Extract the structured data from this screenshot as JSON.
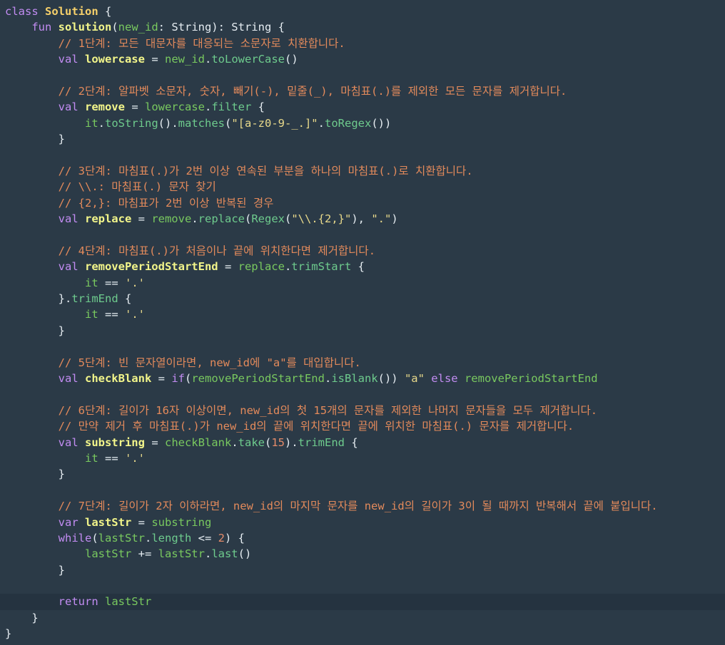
{
  "editor": {
    "lines": [
      {
        "indent": 0,
        "tokens": [
          {
            "t": "class ",
            "c": "kw"
          },
          {
            "t": "Solution",
            "c": "cls bold"
          },
          {
            "t": " {",
            "c": "plain"
          }
        ]
      },
      {
        "indent": 1,
        "tokens": [
          {
            "t": "fun ",
            "c": "kw"
          },
          {
            "t": "solution",
            "c": "fn bold"
          },
          {
            "t": "(",
            "c": "plain"
          },
          {
            "t": "new_id",
            "c": "var"
          },
          {
            "t": ": String): String {",
            "c": "plain"
          }
        ]
      },
      {
        "indent": 2,
        "tokens": [
          {
            "t": "// 1단계: 모든 대문자를 대응되는 소문자로 치환합니다.",
            "c": "cmt"
          }
        ]
      },
      {
        "indent": 2,
        "tokens": [
          {
            "t": "val ",
            "c": "kw"
          },
          {
            "t": "lowercase",
            "c": "id bold"
          },
          {
            "t": " = ",
            "c": "plain"
          },
          {
            "t": "new_id",
            "c": "var"
          },
          {
            "t": ".",
            "c": "plain"
          },
          {
            "t": "toLowerCase",
            "c": "meth"
          },
          {
            "t": "()",
            "c": "plain"
          }
        ]
      },
      {
        "indent": 0,
        "tokens": []
      },
      {
        "indent": 2,
        "tokens": [
          {
            "t": "// 2단계: 알파벳 소문자, 숫자, 빼기(-), 밑줄(_), 마침표(.)를 제외한 모든 문자를 제거합니다.",
            "c": "cmt"
          }
        ]
      },
      {
        "indent": 2,
        "tokens": [
          {
            "t": "val ",
            "c": "kw"
          },
          {
            "t": "remove",
            "c": "id bold"
          },
          {
            "t": " = ",
            "c": "plain"
          },
          {
            "t": "lowercase",
            "c": "var"
          },
          {
            "t": ".",
            "c": "plain"
          },
          {
            "t": "filter",
            "c": "meth"
          },
          {
            "t": " {",
            "c": "plain"
          }
        ]
      },
      {
        "indent": 3,
        "tokens": [
          {
            "t": "it",
            "c": "var"
          },
          {
            "t": ".",
            "c": "plain"
          },
          {
            "t": "toString",
            "c": "meth"
          },
          {
            "t": "().",
            "c": "plain"
          },
          {
            "t": "matches",
            "c": "meth"
          },
          {
            "t": "(",
            "c": "plain"
          },
          {
            "t": "\"[a-z0-9-_.]\"",
            "c": "str"
          },
          {
            "t": ".",
            "c": "plain"
          },
          {
            "t": "toRegex",
            "c": "meth"
          },
          {
            "t": "())",
            "c": "plain"
          }
        ]
      },
      {
        "indent": 2,
        "tokens": [
          {
            "t": "}",
            "c": "plain"
          }
        ]
      },
      {
        "indent": 0,
        "tokens": []
      },
      {
        "indent": 2,
        "tokens": [
          {
            "t": "// 3단계: 마침표(.)가 2번 이상 연속된 부분을 하나의 마침표(.)로 치환합니다.",
            "c": "cmt"
          }
        ]
      },
      {
        "indent": 2,
        "tokens": [
          {
            "t": "// \\\\.: 마침표(.) 문자 찾기",
            "c": "cmt"
          }
        ]
      },
      {
        "indent": 2,
        "tokens": [
          {
            "t": "// {2,}: 마침표가 2번 이상 반복된 경우",
            "c": "cmt"
          }
        ]
      },
      {
        "indent": 2,
        "tokens": [
          {
            "t": "val ",
            "c": "kw"
          },
          {
            "t": "replace",
            "c": "id bold"
          },
          {
            "t": " = ",
            "c": "plain"
          },
          {
            "t": "remove",
            "c": "var"
          },
          {
            "t": ".",
            "c": "plain"
          },
          {
            "t": "replace",
            "c": "meth"
          },
          {
            "t": "(",
            "c": "plain"
          },
          {
            "t": "Regex",
            "c": "meth"
          },
          {
            "t": "(",
            "c": "plain"
          },
          {
            "t": "\"\\\\.{2,}\"",
            "c": "str"
          },
          {
            "t": "), ",
            "c": "plain"
          },
          {
            "t": "\".\"",
            "c": "str"
          },
          {
            "t": ")",
            "c": "plain"
          }
        ]
      },
      {
        "indent": 0,
        "tokens": []
      },
      {
        "indent": 2,
        "tokens": [
          {
            "t": "// 4단계: 마침표(.)가 처음이나 끝에 위치한다면 제거합니다.",
            "c": "cmt"
          }
        ]
      },
      {
        "indent": 2,
        "tokens": [
          {
            "t": "val ",
            "c": "kw"
          },
          {
            "t": "removePeriodStartEnd",
            "c": "id bold"
          },
          {
            "t": " = ",
            "c": "plain"
          },
          {
            "t": "replace",
            "c": "var"
          },
          {
            "t": ".",
            "c": "plain"
          },
          {
            "t": "trimStart",
            "c": "meth"
          },
          {
            "t": " {",
            "c": "plain"
          }
        ]
      },
      {
        "indent": 3,
        "tokens": [
          {
            "t": "it",
            "c": "var"
          },
          {
            "t": " == ",
            "c": "plain"
          },
          {
            "t": "'.'",
            "c": "str"
          }
        ]
      },
      {
        "indent": 2,
        "tokens": [
          {
            "t": "}.",
            "c": "plain"
          },
          {
            "t": "trimEnd",
            "c": "meth"
          },
          {
            "t": " {",
            "c": "plain"
          }
        ]
      },
      {
        "indent": 3,
        "tokens": [
          {
            "t": "it",
            "c": "var"
          },
          {
            "t": " == ",
            "c": "plain"
          },
          {
            "t": "'.'",
            "c": "str"
          }
        ]
      },
      {
        "indent": 2,
        "tokens": [
          {
            "t": "}",
            "c": "plain"
          }
        ]
      },
      {
        "indent": 0,
        "tokens": []
      },
      {
        "indent": 2,
        "tokens": [
          {
            "t": "// 5단계: 빈 문자열이라면, new_id에 \"a\"를 대입합니다.",
            "c": "cmt"
          }
        ]
      },
      {
        "indent": 2,
        "tokens": [
          {
            "t": "val ",
            "c": "kw"
          },
          {
            "t": "checkBlank",
            "c": "id bold"
          },
          {
            "t": " = ",
            "c": "plain"
          },
          {
            "t": "if",
            "c": "kw"
          },
          {
            "t": "(",
            "c": "plain"
          },
          {
            "t": "removePeriodStartEnd",
            "c": "var"
          },
          {
            "t": ".",
            "c": "plain"
          },
          {
            "t": "isBlank",
            "c": "meth"
          },
          {
            "t": "()) ",
            "c": "plain"
          },
          {
            "t": "\"a\"",
            "c": "str"
          },
          {
            "t": " else ",
            "c": "kw"
          },
          {
            "t": "removePeriodStartEnd",
            "c": "var"
          }
        ]
      },
      {
        "indent": 0,
        "tokens": []
      },
      {
        "indent": 2,
        "tokens": [
          {
            "t": "// 6단계: 길이가 16자 이상이면, new_id의 첫 15개의 문자를 제외한 나머지 문자들을 모두 제거합니다.",
            "c": "cmt"
          }
        ]
      },
      {
        "indent": 2,
        "tokens": [
          {
            "t": "// 만약 제거 후 마침표(.)가 new_id의 끝에 위치한다면 끝에 위치한 마침표(.) 문자를 제거합니다.",
            "c": "cmt"
          }
        ]
      },
      {
        "indent": 2,
        "tokens": [
          {
            "t": "val ",
            "c": "kw"
          },
          {
            "t": "substring",
            "c": "id bold"
          },
          {
            "t": " = ",
            "c": "plain"
          },
          {
            "t": "checkBlank",
            "c": "var"
          },
          {
            "t": ".",
            "c": "plain"
          },
          {
            "t": "take",
            "c": "meth"
          },
          {
            "t": "(",
            "c": "plain"
          },
          {
            "t": "15",
            "c": "num"
          },
          {
            "t": ").",
            "c": "plain"
          },
          {
            "t": "trimEnd",
            "c": "meth"
          },
          {
            "t": " {",
            "c": "plain"
          }
        ]
      },
      {
        "indent": 3,
        "tokens": [
          {
            "t": "it",
            "c": "var"
          },
          {
            "t": " == ",
            "c": "plain"
          },
          {
            "t": "'.'",
            "c": "str"
          }
        ]
      },
      {
        "indent": 2,
        "tokens": [
          {
            "t": "}",
            "c": "plain"
          }
        ]
      },
      {
        "indent": 0,
        "tokens": []
      },
      {
        "indent": 2,
        "tokens": [
          {
            "t": "// 7단계: 길이가 2자 이하라면, new_id의 마지막 문자를 new_id의 길이가 3이 될 때까지 반복해서 끝에 붙입니다.",
            "c": "cmt"
          }
        ]
      },
      {
        "indent": 2,
        "tokens": [
          {
            "t": "var ",
            "c": "kw"
          },
          {
            "t": "lastStr",
            "c": "id bold"
          },
          {
            "t": " = ",
            "c": "plain"
          },
          {
            "t": "substring",
            "c": "var"
          }
        ]
      },
      {
        "indent": 2,
        "tokens": [
          {
            "t": "while",
            "c": "kw"
          },
          {
            "t": "(",
            "c": "plain"
          },
          {
            "t": "lastStr",
            "c": "var"
          },
          {
            "t": ".",
            "c": "plain"
          },
          {
            "t": "length",
            "c": "meth"
          },
          {
            "t": " <= ",
            "c": "plain"
          },
          {
            "t": "2",
            "c": "num"
          },
          {
            "t": ") {",
            "c": "plain"
          }
        ]
      },
      {
        "indent": 3,
        "tokens": [
          {
            "t": "lastStr",
            "c": "var"
          },
          {
            "t": " += ",
            "c": "plain"
          },
          {
            "t": "lastStr",
            "c": "var"
          },
          {
            "t": ".",
            "c": "plain"
          },
          {
            "t": "last",
            "c": "meth"
          },
          {
            "t": "()",
            "c": "plain"
          }
        ]
      },
      {
        "indent": 2,
        "tokens": [
          {
            "t": "}",
            "c": "plain"
          }
        ]
      },
      {
        "indent": 0,
        "tokens": []
      },
      {
        "indent": 2,
        "current": true,
        "tokens": [
          {
            "t": "return ",
            "c": "kw"
          },
          {
            "t": "lastStr",
            "c": "var"
          }
        ]
      },
      {
        "indent": 1,
        "tokens": [
          {
            "t": "}",
            "c": "plain"
          }
        ]
      },
      {
        "indent": 0,
        "tokens": [
          {
            "t": "}",
            "c": "plain"
          }
        ]
      }
    ]
  }
}
